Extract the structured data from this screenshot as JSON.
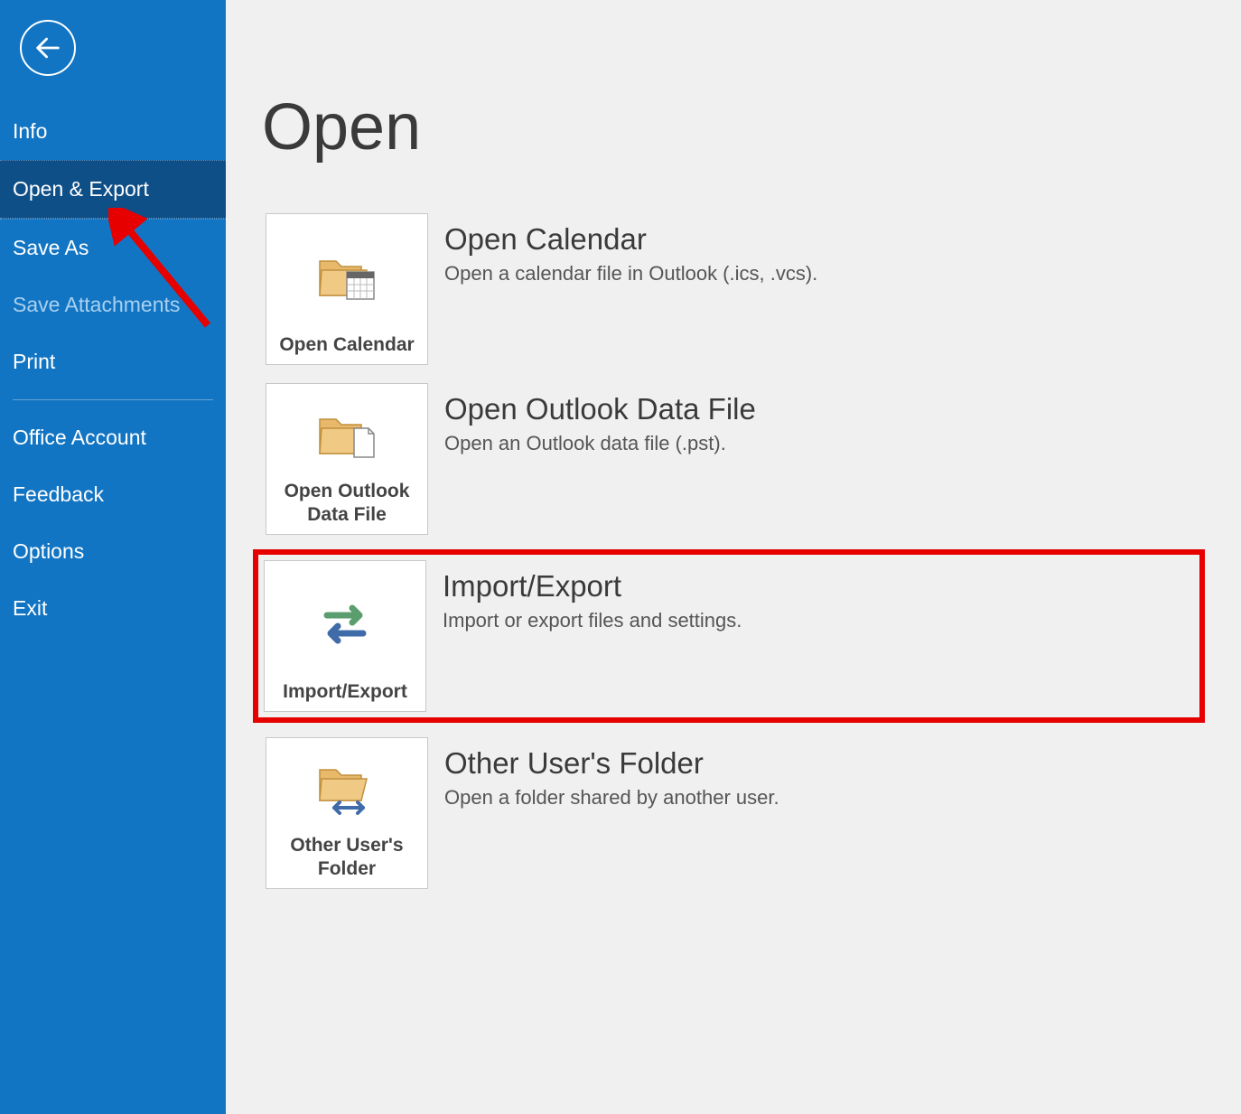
{
  "sidebar": {
    "back_label": "Back",
    "items": [
      {
        "label": "Info",
        "selected": false,
        "disabled": false
      },
      {
        "label": "Open & Export",
        "selected": true,
        "disabled": false
      },
      {
        "label": "Save As",
        "selected": false,
        "disabled": false
      },
      {
        "label": "Save Attachments",
        "selected": false,
        "disabled": true
      },
      {
        "label": "Print",
        "selected": false,
        "disabled": false
      }
    ],
    "footer": [
      {
        "label": "Office Account"
      },
      {
        "label": "Feedback"
      },
      {
        "label": "Options"
      },
      {
        "label": "Exit"
      }
    ]
  },
  "main": {
    "title": "Open",
    "options": [
      {
        "tile_label": "Open Calendar",
        "title": "Open Calendar",
        "desc": "Open a calendar file in Outlook (.ics, .vcs).",
        "icon": "folder-calendar"
      },
      {
        "tile_label": "Open Outlook Data File",
        "title": "Open Outlook Data File",
        "desc": "Open an Outlook data file (.pst).",
        "icon": "folder-file"
      },
      {
        "tile_label": "Import/Export",
        "title": "Import/Export",
        "desc": "Import or export files and settings.",
        "icon": "arrows-swap"
      },
      {
        "tile_label": "Other User's Folder",
        "title": "Other User's Folder",
        "desc": "Open a folder shared by another user.",
        "icon": "folder-share"
      }
    ]
  },
  "annotations": {
    "arrow_target": "Open & Export",
    "box_target": "Import/Export"
  }
}
